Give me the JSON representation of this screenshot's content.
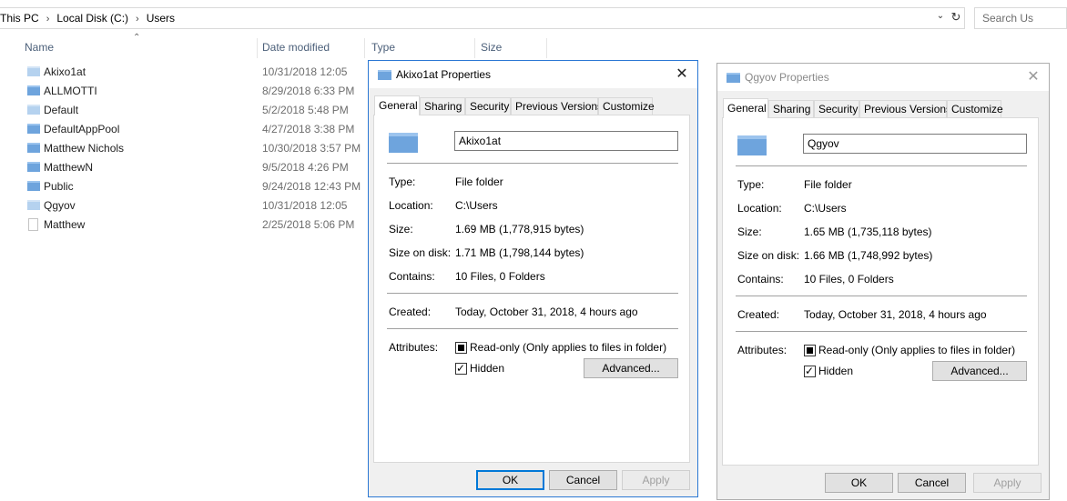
{
  "explorer": {
    "breadcrumb": [
      "This PC",
      "Local Disk (C:)",
      "Users"
    ],
    "search_placeholder": "Search Us",
    "columns": {
      "name": "Name",
      "date": "Date modified",
      "type": "Type",
      "size": "Size"
    },
    "rows": [
      {
        "name": "Akixo1at",
        "date": "10/31/2018 12:05",
        "icon": "folder-faded-icon"
      },
      {
        "name": "ALLMOTTI",
        "date": "8/29/2018 6:33 PM",
        "icon": "folder-icon"
      },
      {
        "name": "Default",
        "date": "5/2/2018 5:48 PM",
        "icon": "folder-faded-icon"
      },
      {
        "name": "DefaultAppPool",
        "date": "4/27/2018 3:38 PM",
        "icon": "folder-icon"
      },
      {
        "name": "Matthew Nichols",
        "date": "10/30/2018 3:57 PM",
        "icon": "folder-icon"
      },
      {
        "name": "MatthewN",
        "date": "9/5/2018 4:26 PM",
        "icon": "folder-icon"
      },
      {
        "name": "Public",
        "date": "9/24/2018 12:43 PM",
        "icon": "folder-icon"
      },
      {
        "name": "Qgyov",
        "date": "10/31/2018 12:05",
        "icon": "folder-faded-icon"
      },
      {
        "name": "Matthew",
        "date": "2/25/2018 5:06 PM",
        "icon": "file-icon"
      }
    ]
  },
  "tabs": [
    "General",
    "Sharing",
    "Security",
    "Previous Versions",
    "Customize"
  ],
  "labels": {
    "type": "Type:",
    "location": "Location:",
    "size": "Size:",
    "size_on_disk": "Size on disk:",
    "contains": "Contains:",
    "created": "Created:",
    "attributes": "Attributes:",
    "readonly": "Read-only (Only applies to files in folder)",
    "hidden": "Hidden",
    "advanced": "Advanced...",
    "ok": "OK",
    "cancel": "Cancel",
    "apply": "Apply"
  },
  "dialog1": {
    "title": "Akixo1at Properties",
    "name": "Akixo1at",
    "type": "File folder",
    "location": "C:\\Users",
    "size": "1.69 MB (1,778,915 bytes)",
    "size_on_disk": "1.71 MB (1,798,144 bytes)",
    "contains": "10 Files, 0 Folders",
    "created": "Today, October 31, 2018, 4 hours ago"
  },
  "dialog2": {
    "title": "Qgyov Properties",
    "name": "Qgyov",
    "type": "File folder",
    "location": "C:\\Users",
    "size": "1.65 MB (1,735,118 bytes)",
    "size_on_disk": "1.66 MB (1,748,992 bytes)",
    "contains": "10 Files, 0 Folders",
    "created": "Today, October 31, 2018, 4 hours ago"
  }
}
